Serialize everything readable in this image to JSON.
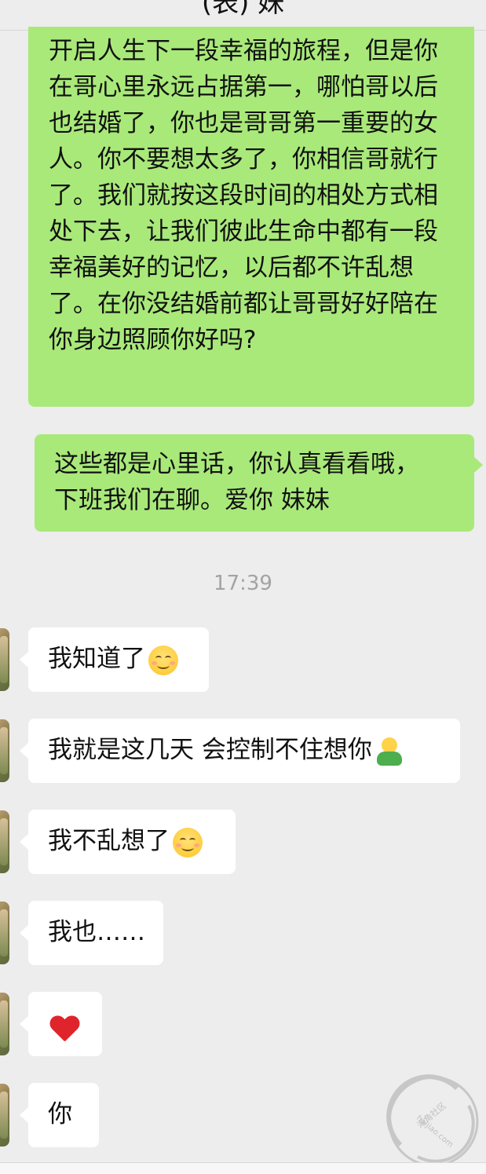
{
  "header": {
    "title": "(表) 妹"
  },
  "messages": {
    "m1_text": "开启人生下一段幸福的旅程，但是你在哥心里永远占据第一，哪怕哥以后也结婚了，你也是哥哥第一重要的女人。你不要想太多了，你相信哥就行了。我们就按这段时间的相处方式相处下去，让我们彼此生命中都有一段幸福美好的记忆，以后都不许乱想了。在你没结婚前都让哥哥好好陪在你身边照顾你好吗?",
    "m2_line1": "这些都是心里话，你认真看看哦，",
    "m2_line2": "下班我们在聊。爱你 妹妹",
    "timestamp": "17:39",
    "r1_text": "我知道了",
    "r1_emoji": "smiling-face-icon",
    "r2_text": "我就是这几天 会控制不住想你",
    "r2_emoji": "hug-figure-icon",
    "r3_text": "我不乱想了",
    "r3_emoji": "pleading-face-icon",
    "r4_text": "我也……",
    "r5_emoji": "red-heart-icon",
    "r6_text": "你"
  },
  "watermark": {
    "line1": "海角社区",
    "line2": "haijiao.com"
  },
  "colors": {
    "outgoing_bubble": "#a9e97a",
    "incoming_bubble": "#ffffff",
    "background": "#ededed",
    "timestamp": "#a3a3a3"
  }
}
